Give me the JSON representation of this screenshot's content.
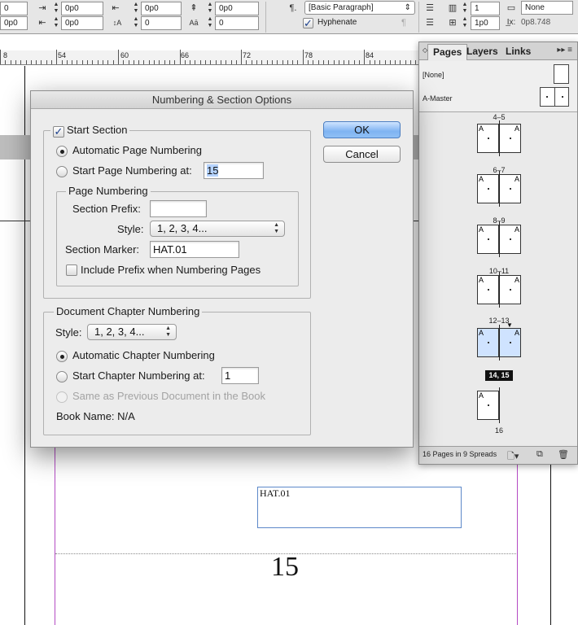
{
  "control_bar": {
    "fields": [
      "0",
      "0p0",
      "0p0",
      "0p0",
      "0",
      "0",
      "0p0",
      "0p0",
      "0",
      "0",
      "1",
      "1p0"
    ],
    "paragraph_style": "[Basic Paragraph]",
    "hyphenate_label": "Hyphenate",
    "hyphenate_checked": true,
    "none_label": "None",
    "offset_value": "0p8.748"
  },
  "ruler": {
    "labels": [
      "8",
      "54",
      "60",
      "66",
      "72",
      "78",
      "84"
    ]
  },
  "canvas": {
    "text_frame_content": "HAT.01",
    "page_number": "15"
  },
  "pages_panel": {
    "tabs": [
      "Pages",
      "Layers",
      "Links"
    ],
    "active_tab": "Pages",
    "masters": [
      "[None]",
      "A-Master"
    ],
    "page_master_letter": "A",
    "spreads": [
      {
        "label": "4–5"
      },
      {
        "label": "6–7"
      },
      {
        "label": "8–9"
      },
      {
        "label": "10–11"
      },
      {
        "label": "12–13"
      },
      {
        "label": "14, 15",
        "selected": true
      },
      {
        "label": "16"
      }
    ],
    "status": "16 Pages in 9 Spreads"
  },
  "dialog": {
    "title": "Numbering & Section Options",
    "start_section": {
      "label": "Start Section",
      "checked": true
    },
    "automatic_page_numbering": {
      "label": "Automatic Page Numbering",
      "selected": true
    },
    "start_page_numbering": {
      "label": "Start Page Numbering at:",
      "value": "15",
      "selected": false
    },
    "page_numbering_group": "Page Numbering",
    "section_prefix_label": "Section Prefix:",
    "section_prefix_value": "",
    "style_label": "Style:",
    "page_style_value": "1, 2, 3, 4...",
    "section_marker_label": "Section Marker:",
    "section_marker_value": "HAT.01",
    "include_prefix": {
      "label": "Include Prefix when Numbering Pages",
      "checked": false
    },
    "chapter_group": "Document Chapter Numbering",
    "chapter_style_label": "Style:",
    "chapter_style_value": "1, 2, 3, 4...",
    "automatic_chapter_numbering": {
      "label": "Automatic Chapter Numbering",
      "selected": true
    },
    "start_chapter_numbering": {
      "label": "Start Chapter Numbering at:",
      "value": "1",
      "selected": false
    },
    "same_as_previous": {
      "label": "Same as Previous Document in the Book",
      "disabled": true
    },
    "book_name": "Book Name: N/A",
    "ok_label": "OK",
    "cancel_label": "Cancel"
  },
  "colors": {
    "accent_button": "#7fb4f2",
    "selection_highlight": "#b5d3ff",
    "frame_border": "#5c88c9",
    "margin_guide": "#b44bc4"
  }
}
